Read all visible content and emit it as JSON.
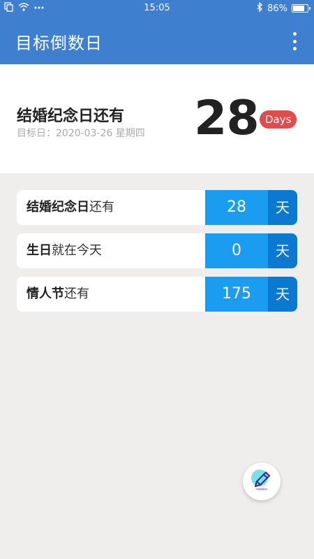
{
  "status_bar": {
    "time": "15:05",
    "battery": "86%",
    "battery_level": 0.86,
    "icons": [
      "copy-icon",
      "wifi-icon",
      "more-dots-icon",
      "bluetooth-icon",
      "battery-icon"
    ]
  },
  "app_bar": {
    "title": "目标倒数日",
    "menu_icon": "more-vert-icon"
  },
  "hero": {
    "title": "结婚纪念日还有",
    "subtitle": "目标日：2020-03-26 星期四",
    "count": "28",
    "badge": "Days"
  },
  "events": [
    {
      "name": "结婚纪念日",
      "suffix": "还有",
      "days": "28",
      "unit": "天"
    },
    {
      "name": "生日",
      "suffix": "就在今天",
      "days": "0",
      "unit": "天"
    },
    {
      "name": "情人节",
      "suffix": "还有",
      "days": "175",
      "unit": "天"
    }
  ],
  "colors": {
    "primary": "#3f7fcf",
    "accent_red": "#e34b4b",
    "num_blue": "#1a9cf0",
    "unit_blue": "#0b79cf",
    "background": "#efeeec"
  },
  "fab": {
    "icon": "edit-pencil-icon"
  }
}
